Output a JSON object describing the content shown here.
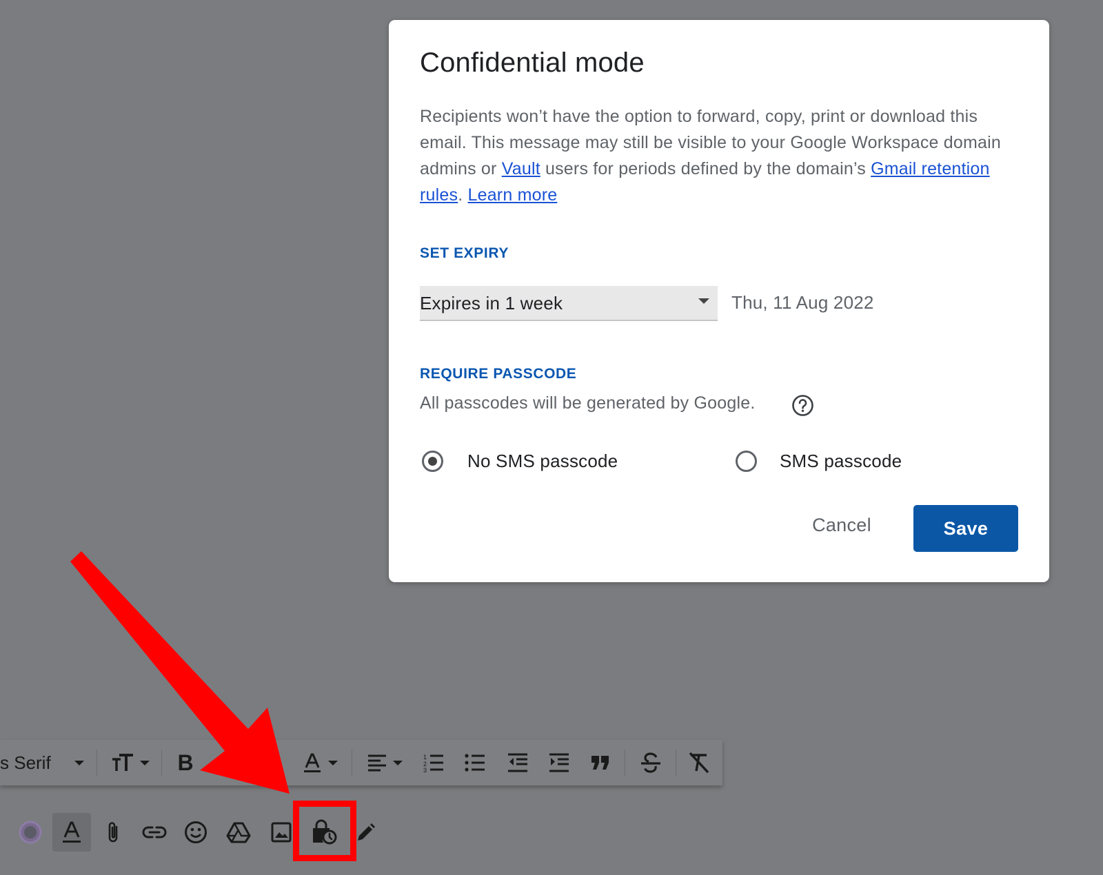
{
  "dialog": {
    "title": "Confidential mode",
    "description": {
      "part1": "Recipients won’t have the option to forward, copy, print or download this email. This message may still be visible to your Google Workspace domain admins or ",
      "vault_link": "Vault",
      "part2": " users for periods defined by the domain’s ",
      "retention_link": "Gmail retention rules",
      "part3": ". ",
      "learn_more_link": "Learn more"
    },
    "expiry": {
      "heading": "SET EXPIRY",
      "selected": "Expires in 1 week",
      "date": "Thu, 11 Aug 2022"
    },
    "passcode": {
      "heading": "REQUIRE PASSCODE",
      "hint": "All passcodes will be generated by Google.",
      "options": [
        {
          "label": "No SMS passcode",
          "selected": true
        },
        {
          "label": "SMS passcode",
          "selected": false
        }
      ]
    },
    "buttons": {
      "cancel": "Cancel",
      "save": "Save"
    }
  },
  "format_toolbar": {
    "font": "s Serif",
    "items": [
      "font-size-icon",
      "bold-icon",
      "text-color-icon",
      "align-icon",
      "numbered-list-icon",
      "bulleted-list-icon",
      "indent-less-icon",
      "indent-more-icon",
      "quote-icon",
      "strikethrough-icon",
      "remove-formatting-icon"
    ],
    "bold_label": "B"
  },
  "bottom_bar": {
    "items": [
      "color-picker-icon",
      "formatting-options-icon",
      "attach-icon",
      "link-icon",
      "emoji-icon",
      "drive-icon",
      "photo-icon",
      "confidential-mode-icon",
      "signature-icon"
    ]
  },
  "colors": {
    "overlay": "#7b7c7f",
    "link": "#1a52d4",
    "heading": "#0b57b0",
    "primary_button": "#0b57a6",
    "annotation": "#ff0000"
  }
}
